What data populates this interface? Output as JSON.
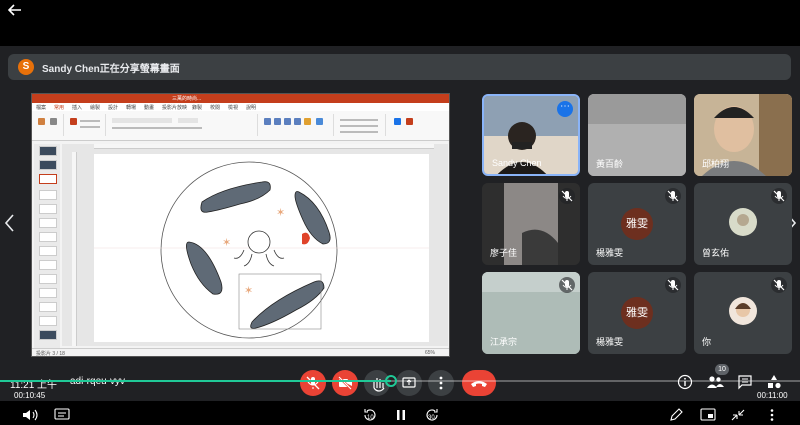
{
  "player": {
    "back_label": "back",
    "time_current": "00:10:45",
    "time_total": "00:11:00",
    "progress": 0.977,
    "rewind_seconds": "10",
    "forward_seconds": "30"
  },
  "banner": {
    "avatar_letter": "S",
    "text": "Sandy Chen正在分享螢幕畫面"
  },
  "presentation": {
    "window_title": "三萬的時尚...",
    "tabs": [
      "檔案",
      "常用",
      "插入",
      "繪製",
      "設計",
      "轉場",
      "動畫",
      "投影片放映",
      "錄製",
      "校閱",
      "檢視",
      "說明"
    ],
    "status": "投影片 3 / 18",
    "zoom": "65%"
  },
  "participants": [
    {
      "name": "Sandy Chen",
      "muted": false,
      "type": "video",
      "more": "⋯"
    },
    {
      "name": "黃百齡",
      "muted": false,
      "type": "video"
    },
    {
      "name": "邱柏翔",
      "muted": false,
      "type": "video"
    },
    {
      "name": "廖子佳",
      "muted": true,
      "type": "video"
    },
    {
      "name": "楊雅雯",
      "muted": true,
      "type": "avatar",
      "avatar_text": "雅雯"
    },
    {
      "name": "曾玄佑",
      "muted": true,
      "type": "small-photo"
    },
    {
      "name": "江承宗",
      "muted": true,
      "type": "video"
    },
    {
      "name": "楊雅雯",
      "muted": true,
      "type": "avatar",
      "avatar_text": "雅雯"
    },
    {
      "name": "你",
      "muted": true,
      "type": "small-photo"
    }
  ],
  "meeting": {
    "clock": "11:21 上午",
    "code": "adi-rqeu-vyv",
    "people_count": "10"
  },
  "colors": {
    "meet_bg": "#202124",
    "tile_bg": "#3c4043",
    "red": "#ea4335",
    "active_border": "#8ab4f8",
    "progress": "#20c997",
    "ppt_accent": "#c43e1c"
  }
}
